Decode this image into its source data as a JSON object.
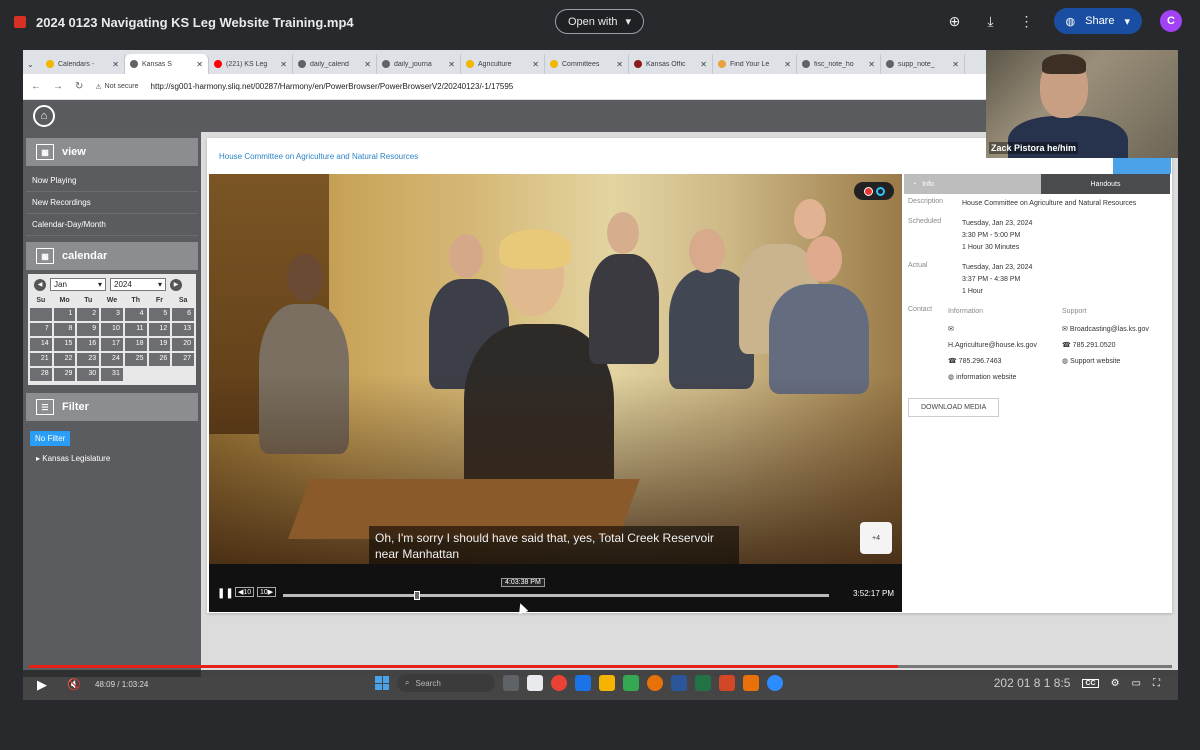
{
  "drive": {
    "file_title": "2024 0123 Navigating KS Leg Website Training.mp4",
    "open_with": "Open with",
    "share": "Share",
    "avatar_initial": "C"
  },
  "browser": {
    "tabs": [
      {
        "label": "Calendars -",
        "color": "#f4b400"
      },
      {
        "label": "Kansas S",
        "color": "#5f6368",
        "active": true
      },
      {
        "label": "(221) KS Leg",
        "color": "#ff0000"
      },
      {
        "label": "daily_calend",
        "color": "#5f6368"
      },
      {
        "label": "daily_journa",
        "color": "#5f6368"
      },
      {
        "label": "Agriculture",
        "color": "#f4b400"
      },
      {
        "label": "Committees",
        "color": "#f4b400"
      },
      {
        "label": "Kansas Offic",
        "color": "#8b1a1a"
      },
      {
        "label": "Find Your Le",
        "color": "#e8a33d"
      },
      {
        "label": "fisc_note_ho",
        "color": "#5f6368"
      },
      {
        "label": "supp_note_",
        "color": "#5f6368"
      }
    ],
    "not_secure": "Not secure",
    "url": "http://sg001-harmony.sliq.net/00287/Harmony/en/PowerBrowser/PowerBrowserV2/20240123/-1/17595"
  },
  "sidebar": {
    "view_title": "view",
    "view_links": [
      "Now Playing",
      "New Recordings",
      "Calendar-Day/Month"
    ],
    "calendar_title": "calendar",
    "month": "Jan",
    "year": "2024",
    "dow": [
      "Su",
      "Mo",
      "Tu",
      "We",
      "Th",
      "Fr",
      "Sa"
    ],
    "days": [
      "",
      "1",
      "2",
      "3",
      "4",
      "5",
      "6",
      "7",
      "8",
      "9",
      "10",
      "11",
      "12",
      "13",
      "14",
      "15",
      "16",
      "17",
      "18",
      "19",
      "20",
      "21",
      "22",
      "23",
      "24",
      "25",
      "26",
      "27",
      "28",
      "29",
      "30",
      "31"
    ],
    "filter_title": "Filter",
    "no_filter": "No Filter",
    "tree_item": "Kansas Legislature"
  },
  "main": {
    "committee_title": "House Committee on Agriculture and Natural Resources",
    "caption": "Oh, I'm sorry I should have said that, yes, Total Creek Reservoir near Manhattan",
    "forward_label": "+4",
    "seek_tip": "4:03:38 PM",
    "seek_position": 0.24,
    "current_time": "3:52:17 PM",
    "skip_back": "10",
    "skip_fwd": "10"
  },
  "info": {
    "tab_info": "Info",
    "tab_handouts": "Handouts",
    "description_key": "Description",
    "description": "House Committee on Agriculture and Natural Resources",
    "scheduled_key": "Scheduled",
    "scheduled_date": "Tuesday, Jan 23, 2024",
    "scheduled_time": "3:30 PM - 5:00 PM",
    "scheduled_duration": "1 Hour 30 Minutes",
    "actual_key": "Actual",
    "actual_date": "Tuesday, Jan 23, 2024",
    "actual_time": "3:37 PM - 4:38 PM",
    "actual_duration": "1 Hour",
    "contact_key": "Contact",
    "information_head": "Information",
    "info_email": "H.Agriculture@house.ks.gov",
    "info_phone": "785.296.7463",
    "info_web": "information website",
    "support_head": "Support",
    "support_email": "Broadcasting@las.ks.gov",
    "support_phone": "785.291.0520",
    "support_web": "Support website",
    "download": "DOWNLOAD MEDIA"
  },
  "webcam": {
    "name": "Zack Pistora he/him"
  },
  "player": {
    "time": "48:09 / 1:03:24",
    "progress": 0.76,
    "search_placeholder": "Search",
    "clock": "202 01 8 1 8:5"
  }
}
